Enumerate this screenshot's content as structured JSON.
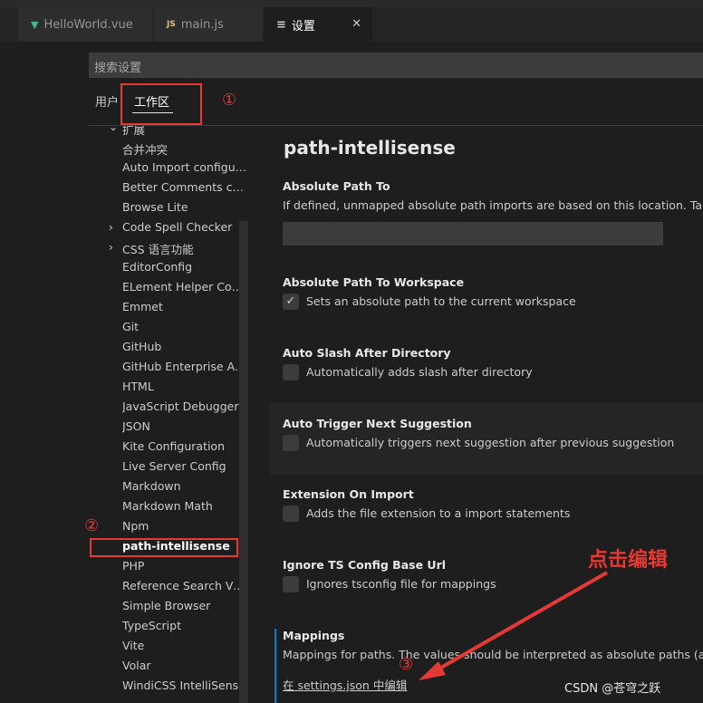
{
  "tabs": [
    {
      "label": "HelloWorld.vue",
      "icon": "vue-icon"
    },
    {
      "label": "main.js",
      "icon": "js-icon"
    },
    {
      "label": "设置",
      "icon": "settings-icon",
      "active": true
    }
  ],
  "search": {
    "placeholder": "搜索设置"
  },
  "scopes": {
    "user": "用户",
    "workspace": "工作区"
  },
  "annotations": {
    "one": "①",
    "two": "②",
    "three": "③",
    "click_edit": "点击编辑",
    "watermark": "CSDN @苍穹之跃"
  },
  "toc": {
    "partial_header": "扩展",
    "items": [
      "合并冲突",
      "Auto Import configura...",
      "Better Comments con...",
      "Browse Lite",
      "Code Spell Checker",
      "CSS 语言功能",
      "EditorConfig",
      "ELement Helper Confi...",
      "Emmet",
      "Git",
      "GitHub",
      "GitHub Enterprise Aut...",
      "HTML",
      "JavaScript Debugger",
      "JSON",
      "Kite Configuration",
      "Live Server Config",
      "Markdown",
      "Markdown Math",
      "Npm",
      "path-intellisense",
      "PHP",
      "Reference Search View",
      "Simple Browser",
      "TypeScript",
      "Vite",
      "Volar",
      "WindiCSS IntelliSense"
    ],
    "selected": "path-intellisense"
  },
  "panel": {
    "title": "path-intellisense",
    "settings": [
      {
        "title": "Absolute Path To",
        "desc": "If defined, unmapped absolute path imports are based on this location. Takes prio"
      },
      {
        "title": "Absolute Path To Workspace",
        "desc": "Sets an absolute path to the current workspace",
        "checked": true
      },
      {
        "title": "Auto Slash After Directory",
        "desc": "Automatically adds slash after directory",
        "checked": false
      },
      {
        "title": "Auto Trigger Next Suggestion",
        "desc": "Automatically triggers next suggestion after previous suggestion",
        "checked": false
      },
      {
        "title": "Extension On Import",
        "desc": "Adds the file extension to a import statements",
        "checked": false
      },
      {
        "title": "Ignore TS Config Base Url",
        "desc": "Ignores tsconfig file for mappings",
        "checked": false
      },
      {
        "title": "Mappings",
        "desc": "Mappings for paths. The values should be interpreted as absolute paths (and can"
      }
    ],
    "edit_link": "在 settings.json 中编辑"
  },
  "colors": {
    "annotation": "#e53935",
    "focus": "#007fd4",
    "vue": "#41b883"
  }
}
